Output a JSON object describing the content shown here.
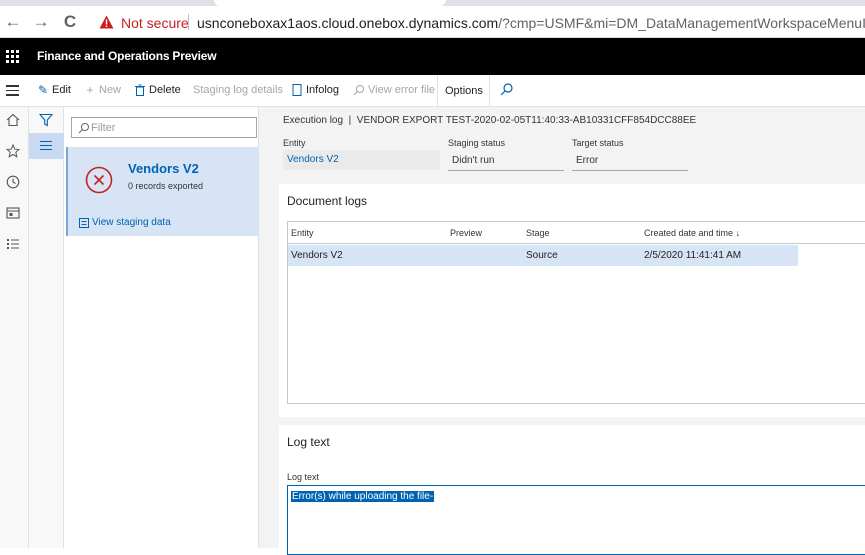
{
  "browser": {
    "nav": {
      "back": "←",
      "forward": "→",
      "reload": "C"
    },
    "security_label": "Not secure",
    "url_host": "usnconeboxax1aos.cloud.onebox.dynamics.com",
    "url_path": "/?cmp=USMF&mi=DM_DataManagementWorkspaceMenuItem"
  },
  "app": {
    "title": "Finance and Operations Preview"
  },
  "actions": {
    "edit": "Edit",
    "new": "New",
    "delete": "Delete",
    "staging_log": "Staging log details",
    "infolog": "Infolog",
    "view_error": "View error file",
    "options": "Options"
  },
  "list": {
    "filter_placeholder": "Filter",
    "card": {
      "title": "Vendors V2",
      "subtitle": "0 records exported",
      "link": "View staging data"
    }
  },
  "detail": {
    "execution_label": "Execution log",
    "divider": "|",
    "job_id": "VENDOR EXPORT TEST-2020-02-05T11:40:33-AB10331CFF854DCC88EE",
    "fields": {
      "entity_label": "Entity",
      "entity_value": "Vendors V2",
      "staging_label": "Staging status",
      "staging_value": "Didn't run",
      "target_label": "Target status",
      "target_value": "Error"
    },
    "doc_logs": {
      "title": "Document logs",
      "columns": [
        "Entity",
        "Preview",
        "Stage",
        "Created date and time"
      ],
      "sort_arrow": "↓",
      "rows": [
        {
          "entity": "Vendors V2",
          "preview": "",
          "stage": "Source",
          "created": "2/5/2020 11:41:41 AM"
        }
      ]
    },
    "log_text": {
      "title": "Log text",
      "label": "Log text",
      "value": "Error(s) while uploading the file-"
    }
  },
  "colors": {
    "accent": "#0063b1",
    "error": "#c5221f",
    "selected": "#d7e4f5"
  }
}
